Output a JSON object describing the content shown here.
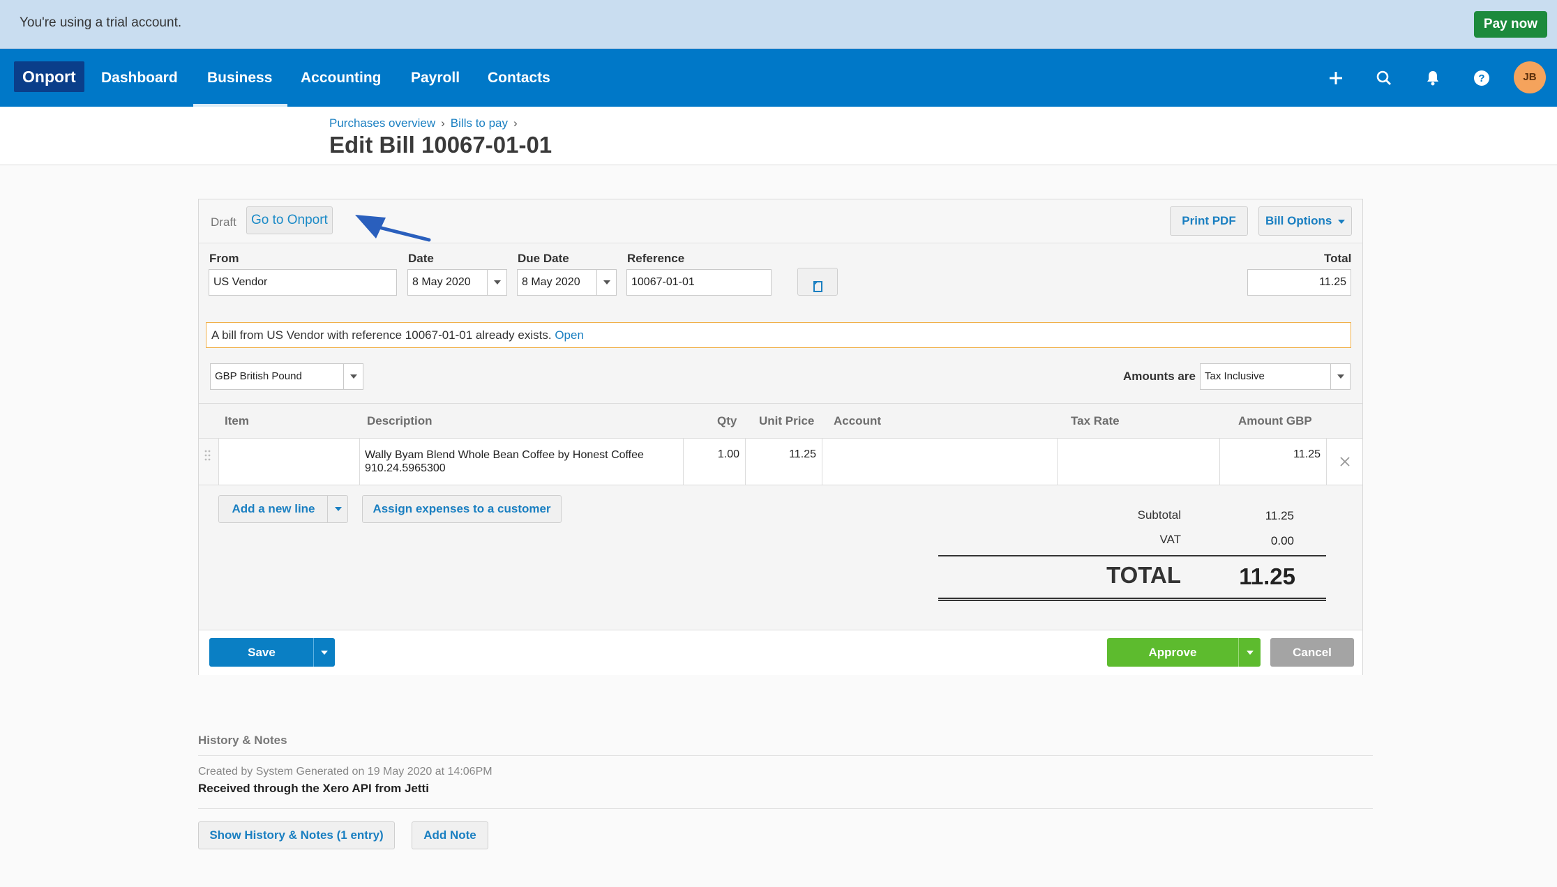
{
  "trial_banner": {
    "text": "You're using a trial account.",
    "pay_now": "Pay now"
  },
  "nav": {
    "brand": "Onport",
    "items": [
      {
        "label": "Dashboard"
      },
      {
        "label": "Business",
        "active": true
      },
      {
        "label": "Accounting"
      },
      {
        "label": "Payroll"
      },
      {
        "label": "Contacts"
      }
    ],
    "icons": [
      "plus-icon",
      "search-icon",
      "bell-icon",
      "help-icon"
    ],
    "avatar_initials": "JB"
  },
  "breadcrumb": {
    "items": [
      "Purchases overview",
      "Bills to pay"
    ],
    "separator": "›"
  },
  "page_title": "Edit Bill 10067-01-01",
  "bill": {
    "status": "Draft",
    "goto_label": "Go to Onport",
    "print_pdf": "Print PDF",
    "bill_options": "Bill Options",
    "from_label": "From",
    "from_value": "US Vendor",
    "date_label": "Date",
    "date_value": "8 May 2020",
    "due_label": "Due Date",
    "due_value": "8 May 2020",
    "reference_label": "Reference",
    "reference_value": "10067-01-01",
    "total_label": "Total",
    "total_value": "11.25",
    "duplicate_warning": "A bill from US Vendor with reference 10067-01-01 already exists.",
    "duplicate_link": "Open",
    "currency": "GBP British Pound",
    "amounts_are_label": "Amounts are",
    "amounts_are_value": "Tax Inclusive",
    "columns": [
      "Item",
      "Description",
      "Qty",
      "Unit Price",
      "Account",
      "Tax Rate",
      "Amount GBP"
    ],
    "line": {
      "item": "",
      "description_1": "Wally Byam Blend Whole Bean Coffee by Honest Coffee",
      "description_2": "910.24.5965300",
      "qty": "1.00",
      "unit_price": "11.25",
      "account": "",
      "tax_rate": "",
      "amount": "11.25"
    },
    "add_line": "Add a new line",
    "assign_expenses": "Assign expenses to a customer",
    "subtotal_label": "Subtotal",
    "subtotal_value": "11.25",
    "vat_label": "VAT",
    "vat_value": "0.00",
    "grand_total_label": "TOTAL",
    "grand_total_value": "11.25",
    "save": "Save",
    "approve": "Approve",
    "cancel": "Cancel"
  },
  "history": {
    "title": "History & Notes",
    "meta": "Created by System Generated on 19 May 2020 at 14:06PM",
    "note": "Received through the Xero API from Jetti",
    "show_history": "Show History & Notes (1 entry)",
    "add_note": "Add Note"
  },
  "colors": {
    "nav_bg": "#0078c8",
    "brand_bg": "#0a3e8a",
    "pay_now": "#1c8a3c",
    "save": "#0a7fc4",
    "approve": "#5dbb2e",
    "cancel": "#a4a4a4",
    "warning_border": "#f0b04a"
  }
}
